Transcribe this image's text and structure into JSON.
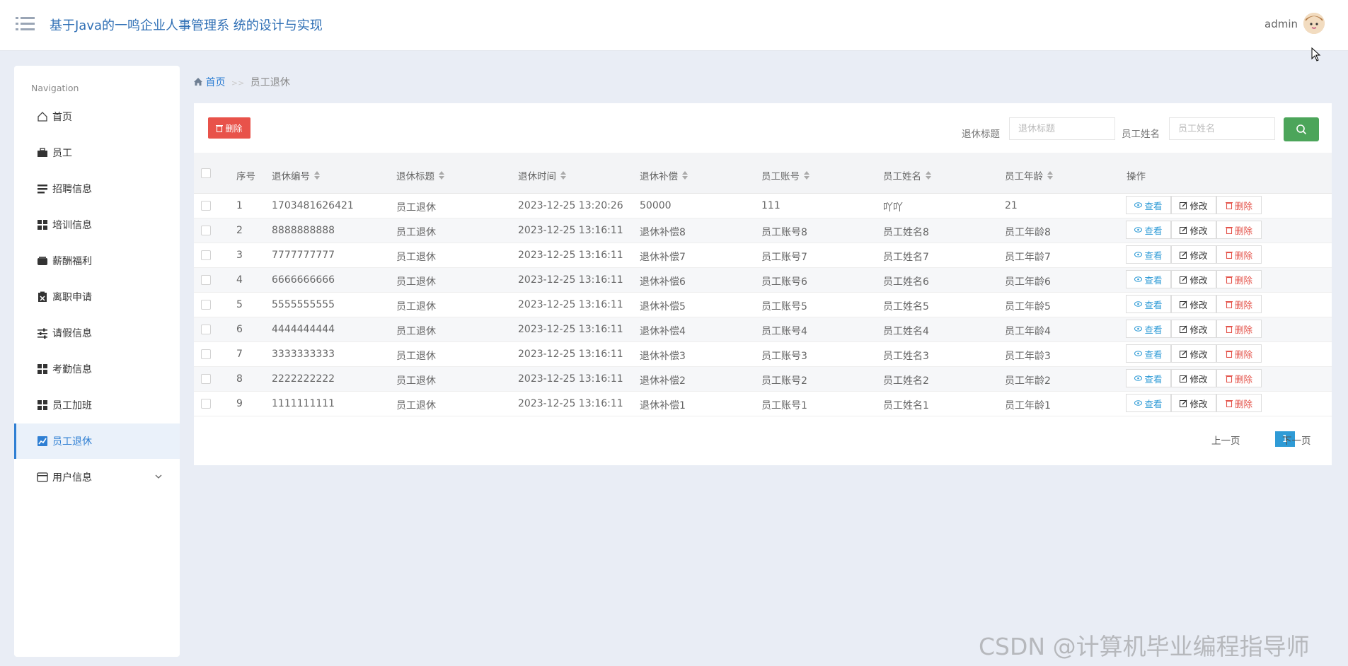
{
  "header": {
    "title": "基于Java的一鸣企业人事管理系 统的设计与实现",
    "user": "admin"
  },
  "sidebar": {
    "title": "Navigation",
    "items": [
      {
        "label": "首页",
        "icon": "home-icon"
      },
      {
        "label": "员工",
        "icon": "briefcase-icon"
      },
      {
        "label": "招聘信息",
        "icon": "list-icon"
      },
      {
        "label": "培训信息",
        "icon": "grid-icon"
      },
      {
        "label": "薪酬福利",
        "icon": "wallet-icon"
      },
      {
        "label": "离职申请",
        "icon": "clipboard-x-icon"
      },
      {
        "label": "请假信息",
        "icon": "sliders-icon"
      },
      {
        "label": "考勤信息",
        "icon": "grid-icon"
      },
      {
        "label": "员工加班",
        "icon": "grid-icon"
      },
      {
        "label": "员工退休",
        "icon": "chart-icon",
        "active": true
      },
      {
        "label": "用户信息",
        "icon": "card-icon"
      }
    ]
  },
  "breadcrumb": {
    "home": "首页",
    "sep": ">>",
    "current": "员工退休"
  },
  "toolbar": {
    "delete_label": "删除",
    "filter1_label": "退休标题",
    "filter1_placeholder": "退休标题",
    "filter2_label": "员工姓名",
    "filter2_placeholder": "员工姓名"
  },
  "table": {
    "headers": [
      "序号",
      "退休编号",
      "退休标题",
      "退休时间",
      "退休补偿",
      "员工账号",
      "员工姓名",
      "员工年龄",
      "操作"
    ],
    "rows": [
      [
        "1",
        "1703481626421",
        "员工退休",
        "2023-12-25 13:20:26",
        "50000",
        "111",
        "吖吖",
        "21"
      ],
      [
        "2",
        "8888888888",
        "员工退休",
        "2023-12-25 13:16:11",
        "退休补偿8",
        "员工账号8",
        "员工姓名8",
        "员工年龄8"
      ],
      [
        "3",
        "7777777777",
        "员工退休",
        "2023-12-25 13:16:11",
        "退休补偿7",
        "员工账号7",
        "员工姓名7",
        "员工年龄7"
      ],
      [
        "4",
        "6666666666",
        "员工退休",
        "2023-12-25 13:16:11",
        "退休补偿6",
        "员工账号6",
        "员工姓名6",
        "员工年龄6"
      ],
      [
        "5",
        "5555555555",
        "员工退休",
        "2023-12-25 13:16:11",
        "退休补偿5",
        "员工账号5",
        "员工姓名5",
        "员工年龄5"
      ],
      [
        "6",
        "4444444444",
        "员工退休",
        "2023-12-25 13:16:11",
        "退休补偿4",
        "员工账号4",
        "员工姓名4",
        "员工年龄4"
      ],
      [
        "7",
        "3333333333",
        "员工退休",
        "2023-12-25 13:16:11",
        "退休补偿3",
        "员工账号3",
        "员工姓名3",
        "员工年龄3"
      ],
      [
        "8",
        "2222222222",
        "员工退休",
        "2023-12-25 13:16:11",
        "退休补偿2",
        "员工账号2",
        "员工姓名2",
        "员工年龄2"
      ],
      [
        "9",
        "1111111111",
        "员工退休",
        "2023-12-25 13:16:11",
        "退休补偿1",
        "员工账号1",
        "员工姓名1",
        "员工年龄1"
      ]
    ],
    "actions": {
      "view": "查看",
      "edit": "修改",
      "delete": "删除"
    }
  },
  "pagination": {
    "prev": "上一页",
    "current": "1",
    "next": "下一页"
  },
  "watermark": "CSDN @计算机毕业编程指导师",
  "colors": {
    "accent": "#2f7fd3",
    "danger": "#e8524a",
    "search": "#4ca55a"
  }
}
